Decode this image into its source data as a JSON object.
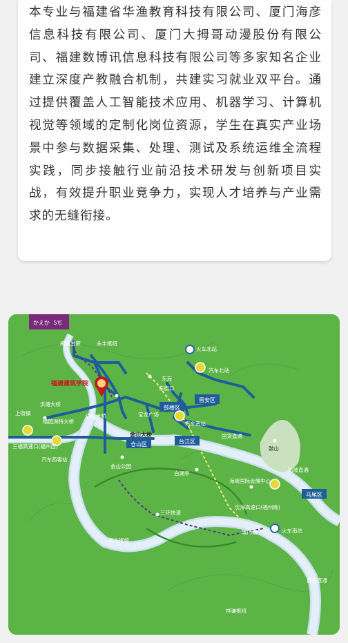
{
  "article": {
    "paragraph": "本专业与福建省华渔教育科技有限公司、厦门海彦信息科技有限公司、厦门大拇哥动漫股份有限公司、福建数博讯信息科技有限公司等多家知名企业建立深度产教融合机制，共建实习就业双平台。通过提供覆盖人工智能技术应用、机器学习、计算机视觉等领域的定制化岗位资源，学生在真实产业场景中参与数据采集、处理、测试及系统运维全流程实践，同步接触行业前沿技术研发与创新项目实战，有效提升职业竞争力，实现人才培养与产业需求的无缝衔接。"
  },
  "map": {
    "logo_left": "かえか",
    "logo_right": "5ぢ",
    "school": "福建建筑学院",
    "labels": {
      "minhou_ganzhe": "闽侯甘蔗",
      "yongfeng": "永丰枢纽",
      "huoche_bei_top": "火车北站",
      "qiche_bei": "汽车北站",
      "donghai": "东海",
      "dongjiekou": "东街口",
      "gulou": "鼓楼区",
      "jinan": "晋安区",
      "hongtang_bridge": "洪塘大桥",
      "shangjie": "上街镇",
      "hongshan_bridge": "洪山大桥",
      "baolong": "宝龙广场",
      "qiche_nan": "汽车南站",
      "jushan_bridge": "橘园洲特大桥",
      "sanfu_west": "三福高速口(福州西)",
      "jinshan_bridge": "金山大桥",
      "cangshan": "仓山区",
      "taijiang": "台江区",
      "guohuo": "国货直通",
      "gushan": "鼓山",
      "qiche_xi": "汽车西客站",
      "jinshan_park": "金山公园",
      "baihuting": "白湖亭",
      "expo": "海峡国际会展中心",
      "kuiqi": "魁岐直通",
      "mawei": "马尾区",
      "sanhuan": "三环快速",
      "shenhai": "沈海高速口(福州南)",
      "chengmen": "城门镇",
      "huoche_nan": "火车南站",
      "nanyu": "南屿枢纽",
      "huangshi": "黄石直通",
      "xiangqian": "祥谦枢纽"
    }
  }
}
